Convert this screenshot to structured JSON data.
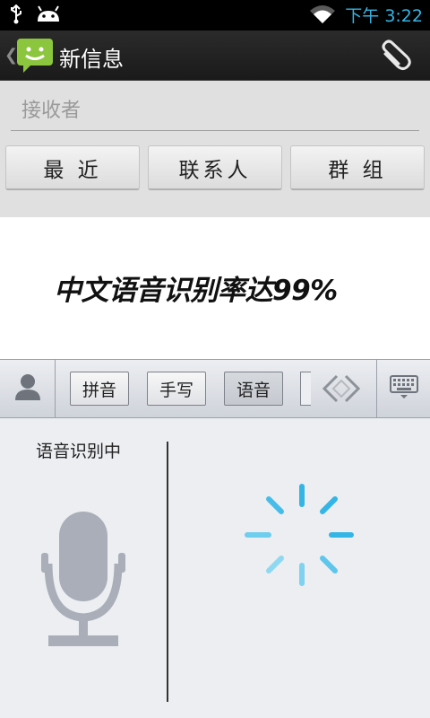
{
  "status_bar": {
    "time": "下午 3:22",
    "icons": [
      "usb-icon",
      "android-icon",
      "wifi-icon"
    ]
  },
  "action_bar": {
    "title": "新信息",
    "icons": [
      "back-chevron-icon",
      "messaging-app-icon",
      "paperclip-icon"
    ]
  },
  "recipient": {
    "placeholder": "接收者",
    "buttons": [
      {
        "label": "最 近"
      },
      {
        "label": "联系人"
      },
      {
        "label": "群 组"
      }
    ]
  },
  "message": {
    "promo_text": "中文语音识别率达99%"
  },
  "ime": {
    "tabs": [
      {
        "label": "拼音",
        "active": false
      },
      {
        "label": "手写",
        "active": false
      },
      {
        "label": "语音",
        "active": true
      }
    ],
    "icons": [
      "user-icon",
      "arrows-icon",
      "keyboard-icon"
    ]
  },
  "voice": {
    "status": "语音识别中",
    "icons": [
      "microphone-icon",
      "loading-spinner-icon"
    ],
    "spinner_color": "#33b5e5"
  },
  "colors": {
    "accent": "#33b5e5",
    "action_bar": "#1f1f1f",
    "panel": "#e0e0e0"
  }
}
